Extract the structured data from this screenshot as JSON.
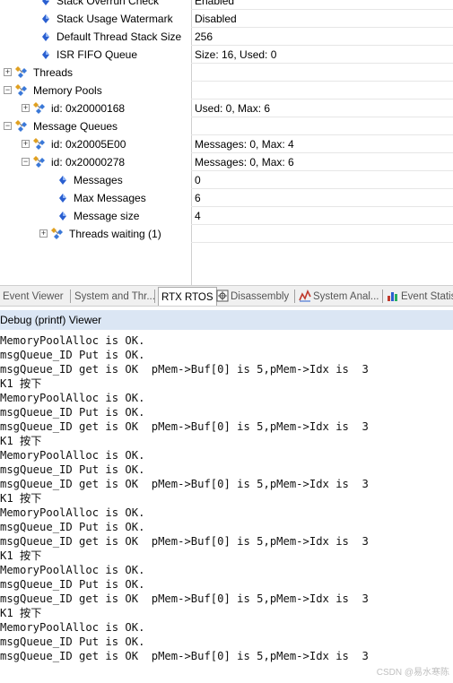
{
  "tree": {
    "rows": [
      {
        "label": "Stack Overrun Check",
        "value": "Enabled",
        "level": 2,
        "kind": "prop",
        "expander": ""
      },
      {
        "label": "Stack Usage Watermark",
        "value": "Disabled",
        "level": 2,
        "kind": "prop",
        "expander": ""
      },
      {
        "label": "Default Thread Stack Size",
        "value": "256",
        "level": 2,
        "kind": "prop",
        "expander": ""
      },
      {
        "label": "ISR FIFO Queue",
        "value": "Size: 16, Used: 0",
        "level": 2,
        "kind": "prop",
        "expander": ""
      },
      {
        "label": "Threads",
        "value": "",
        "level": 0,
        "kind": "group",
        "expander": "+"
      },
      {
        "label": "Memory Pools",
        "value": "",
        "level": 0,
        "kind": "group",
        "expander": "-"
      },
      {
        "label": "id: 0x20000168",
        "value": "Used: 0, Max: 6",
        "level": 1,
        "kind": "group",
        "expander": "+"
      },
      {
        "label": "Message Queues",
        "value": "",
        "level": 0,
        "kind": "group",
        "expander": "-"
      },
      {
        "label": "id: 0x20005E00",
        "value": "Messages: 0, Max: 4",
        "level": 1,
        "kind": "group",
        "expander": "+"
      },
      {
        "label": "id: 0x20000278",
        "value": "Messages: 0, Max: 6",
        "level": 1,
        "kind": "group",
        "expander": "-"
      },
      {
        "label": "Messages",
        "value": "0",
        "level": 3,
        "kind": "prop",
        "expander": ""
      },
      {
        "label": "Max Messages",
        "value": "6",
        "level": 3,
        "kind": "prop",
        "expander": ""
      },
      {
        "label": "Message size",
        "value": "4",
        "level": 3,
        "kind": "prop",
        "expander": ""
      },
      {
        "label": "Threads waiting (1)",
        "value": "",
        "level": 2,
        "kind": "group",
        "expander": "+"
      }
    ]
  },
  "tabs": [
    {
      "label": "Event Viewer",
      "icon": "",
      "active": false
    },
    {
      "label": "System and Thr...",
      "icon": "",
      "active": false
    },
    {
      "label": "RTX RTOS",
      "icon": "",
      "active": true
    },
    {
      "label": "Disassembly",
      "icon": "disassembly-icon",
      "active": false
    },
    {
      "label": "System Anal...",
      "icon": "system-analyzer-icon",
      "active": false
    },
    {
      "label": "Event Statis",
      "icon": "event-statistics-icon",
      "active": false
    }
  ],
  "debug": {
    "title": "Debug (printf) Viewer",
    "lines": [
      "MemoryPoolAlloc is OK.",
      "msgQueue_ID Put is OK.",
      "msgQueue_ID get is OK  pMem->Buf[0] is 5,pMem->Idx is  3",
      "K1 按下",
      "MemoryPoolAlloc is OK.",
      "msgQueue_ID Put is OK.",
      "msgQueue_ID get is OK  pMem->Buf[0] is 5,pMem->Idx is  3",
      "K1 按下",
      "MemoryPoolAlloc is OK.",
      "msgQueue_ID Put is OK.",
      "msgQueue_ID get is OK  pMem->Buf[0] is 5,pMem->Idx is  3",
      "K1 按下",
      "MemoryPoolAlloc is OK.",
      "msgQueue_ID Put is OK.",
      "msgQueue_ID get is OK  pMem->Buf[0] is 5,pMem->Idx is  3",
      "K1 按下",
      "MemoryPoolAlloc is OK.",
      "msgQueue_ID Put is OK.",
      "msgQueue_ID get is OK  pMem->Buf[0] is 5,pMem->Idx is  3",
      "K1 按下",
      "MemoryPoolAlloc is OK.",
      "msgQueue_ID Put is OK.",
      "msgQueue_ID get is OK  pMem->Buf[0] is 5,pMem->Idx is  3"
    ]
  },
  "watermark": "CSDN @易水寒陈",
  "colors": {
    "title_bar": "#dbe6f4",
    "prop_icon": "#2a5fd0",
    "group_icon_a": "#e0a020",
    "group_icon_b": "#3a78d8"
  }
}
